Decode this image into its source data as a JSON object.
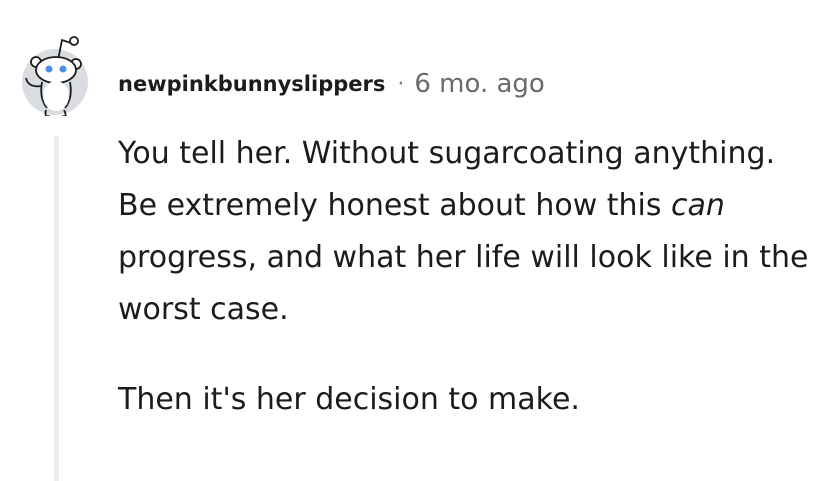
{
  "comment": {
    "username": "newpinkbunnyslippers",
    "separator": "·",
    "timestamp": "6 mo. ago",
    "body": {
      "line1": "You tell her. Without sugarcoating anything.",
      "line2_before": "Be extremely honest about how this ",
      "line2_emphasis": "can",
      "line2_after": " progress, and what her life will look like in the worst case.",
      "line3": "Then it's her decision to make."
    }
  },
  "avatar": {
    "icon": "snoo-avatar-icon",
    "colors": {
      "face": "#ffffff",
      "outline": "#1c1c1c",
      "eyes": "#4a90e2",
      "circle": "#d9dde2"
    }
  },
  "thread": {
    "line_color": "#ededed"
  }
}
